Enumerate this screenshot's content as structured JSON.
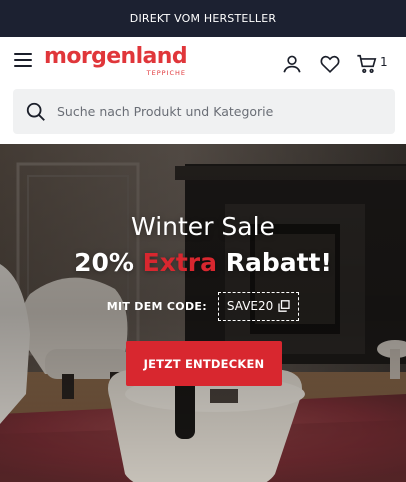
{
  "topbar": {
    "text": "DIREKT VOM HERSTELLER"
  },
  "header": {
    "brand": "morgenland",
    "brand_sub": "TEPPICHE",
    "cart_count": "1",
    "accent": "#e0363a"
  },
  "search": {
    "placeholder": "Suche nach Produkt und Kategorie"
  },
  "hero": {
    "title_line1": "Winter Sale",
    "title_line2_a": "20% ",
    "title_line2_b": "Extra",
    "title_line2_c": " Rabatt!",
    "code_label": "MIT DEM CODE:",
    "code": "SAVE20",
    "cta_label": "JETZT ENTDECKEN",
    "cta_color": "#d8272f"
  },
  "icons": [
    "menu-icon",
    "user-icon",
    "heart-icon",
    "cart-icon",
    "search-icon",
    "copy-icon"
  ]
}
